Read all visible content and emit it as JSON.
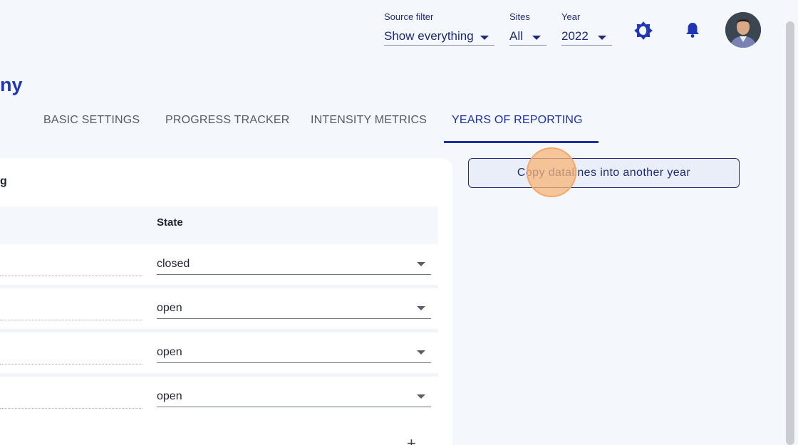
{
  "header": {
    "source_filter": {
      "label": "Source filter",
      "value": "Show everything"
    },
    "sites": {
      "label": "Sites",
      "value": "All"
    },
    "year": {
      "label": "Year",
      "value": "2022"
    },
    "icons": [
      "brightness-icon",
      "bell-icon",
      "avatar"
    ]
  },
  "page": {
    "title_fragment": "ny"
  },
  "tabs": [
    {
      "label": "BASIC SETTINGS",
      "active": false
    },
    {
      "label": "PROGRESS TRACKER",
      "active": false
    },
    {
      "label": "INTENSITY METRICS",
      "active": false
    },
    {
      "label": "YEARS OF REPORTING",
      "active": true
    }
  ],
  "card": {
    "title_fragment": "g",
    "column_header": "State",
    "rows": [
      {
        "state": "closed"
      },
      {
        "state": "open"
      },
      {
        "state": "open"
      },
      {
        "state": "open"
      }
    ],
    "add_symbol": "+"
  },
  "actions": {
    "copy_label": "Copy datalines into another year"
  },
  "colors": {
    "accent": "#1e2fa8",
    "background": "#f4f7fb",
    "highlight": "#f7b478"
  }
}
